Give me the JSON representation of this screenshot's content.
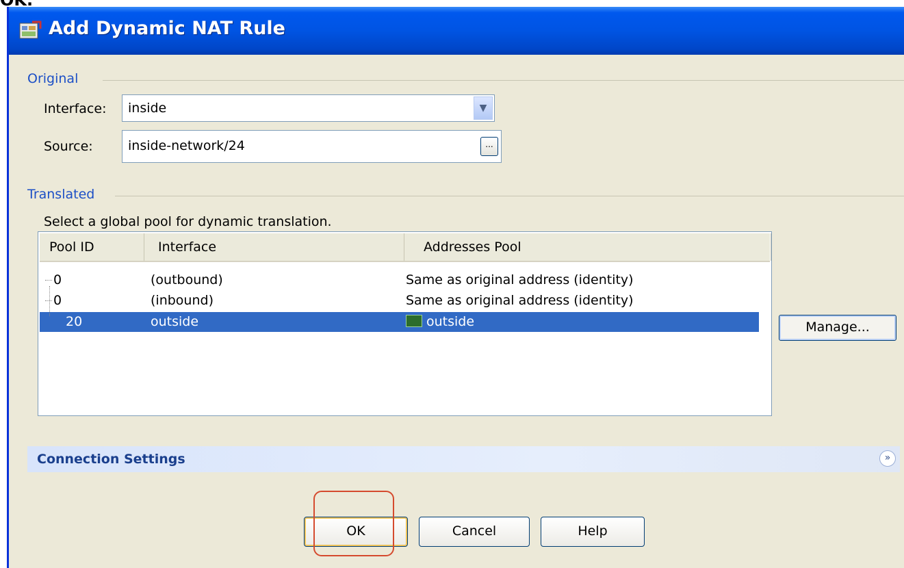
{
  "window": {
    "cropped_caption": "OK.",
    "title": "Add Dynamic NAT Rule",
    "title_icon": "nat-rule-icon"
  },
  "original": {
    "group_label": "Original",
    "interface_label": "Interface:",
    "interface_value": "inside",
    "source_label": "Source:",
    "source_value": "inside-network/24",
    "browse_label": "..."
  },
  "translated": {
    "group_label": "Translated",
    "hint": "Select a global pool for dynamic translation.",
    "columns": [
      "Pool ID",
      "Interface",
      "Addresses Pool"
    ],
    "rows": [
      {
        "pool_id": "0",
        "interface": "(outbound)",
        "addresses_pool": "Same as original address (identity)",
        "selected": false
      },
      {
        "pool_id": "0",
        "interface": "(inbound)",
        "addresses_pool": "Same as original address (identity)",
        "selected": false
      },
      {
        "pool_id": "20",
        "interface": "outside",
        "addresses_pool": "outside",
        "selected": true
      }
    ],
    "manage_label": "Manage..."
  },
  "connection_settings": {
    "label": "Connection Settings",
    "expand_icon": "double-chevron-down-icon"
  },
  "buttons": {
    "ok": "OK",
    "cancel": "Cancel",
    "help": "Help"
  },
  "colors": {
    "titlebar": "#0054e3",
    "selection": "#316ac5",
    "group_label": "#1c4fc6",
    "annotation": "#d54a2e"
  }
}
